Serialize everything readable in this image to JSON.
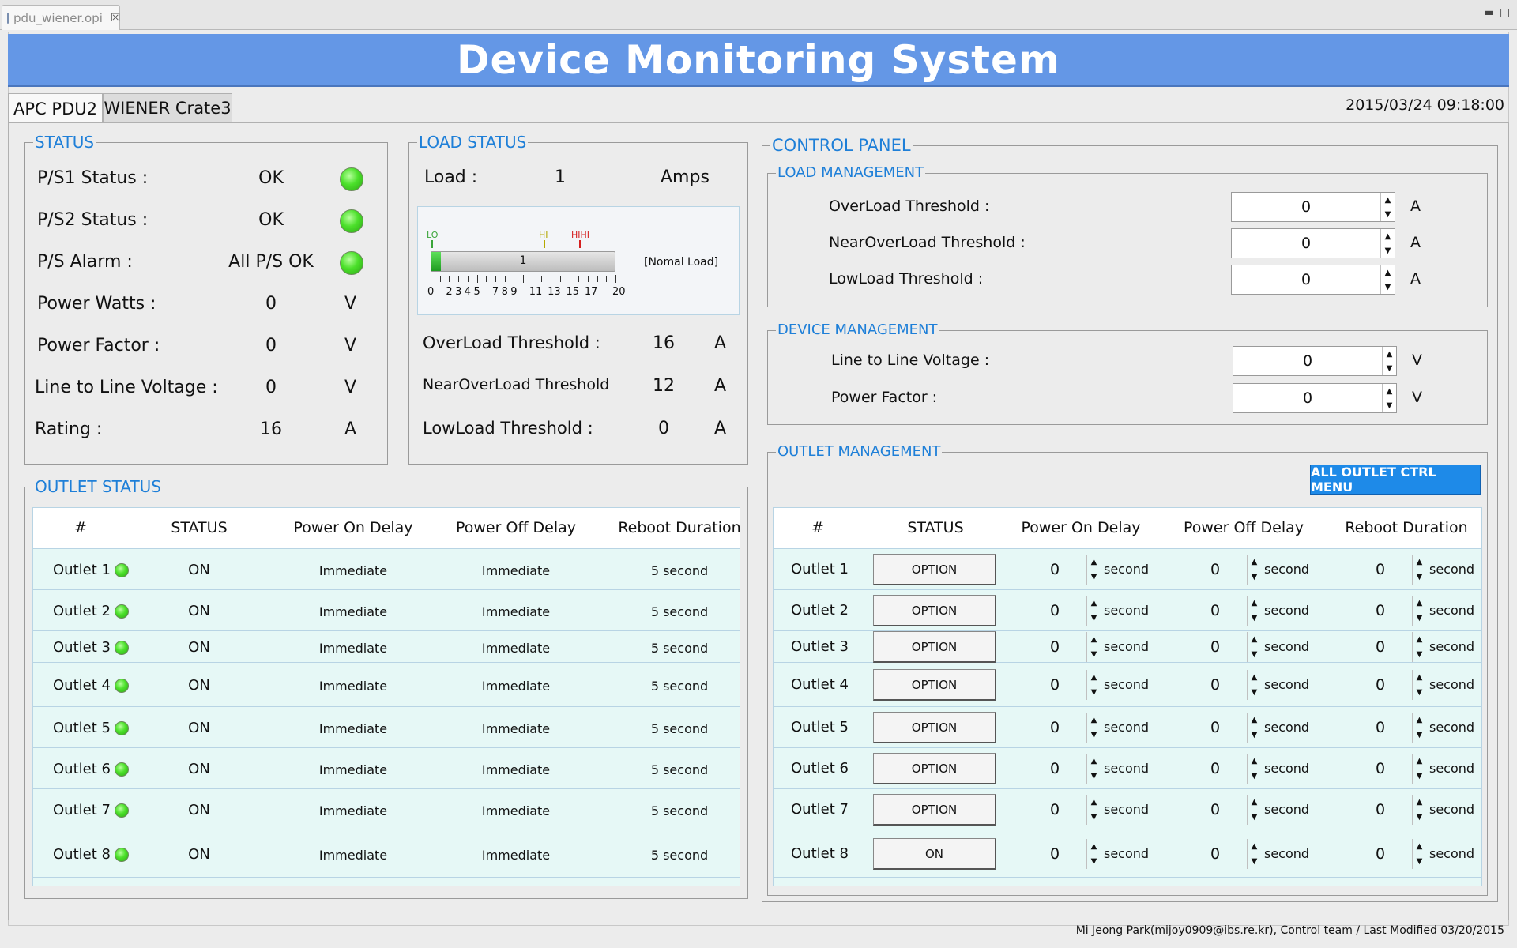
{
  "editor_tab": {
    "title": "pdu_wiener.opi",
    "close": "☒"
  },
  "banner": {
    "title": "Device Monitoring System"
  },
  "device_tabs": [
    {
      "label": "APC PDU2"
    },
    {
      "label": "WIENER Crate3"
    }
  ],
  "datetime": "2015/03/24 09:18:00",
  "status": {
    "title": "STATUS",
    "rows": [
      {
        "label": "P/S1 Status :",
        "value": "OK",
        "indicator": "led-green"
      },
      {
        "label": "P/S2 Status :",
        "value": "OK",
        "indicator": "led-green"
      },
      {
        "label": "P/S Alarm :",
        "value": "All P/S OK",
        "indicator": "led-green"
      },
      {
        "label": "Power Watts :",
        "value": "0",
        "unit": "V"
      },
      {
        "label": "Power Factor :",
        "value": "0",
        "unit": "V"
      },
      {
        "label": "Line to Line Voltage :",
        "value": "0",
        "unit": "V"
      },
      {
        "label": "Rating :",
        "value": "16",
        "unit": "A"
      }
    ]
  },
  "load_status": {
    "title": "LOAD STATUS",
    "load_label": "Load :",
    "load_value": "1",
    "load_unit": "Amps",
    "gauge": {
      "value": 1,
      "min": 0,
      "max": 20,
      "value_text": "1",
      "lo_label": "LO",
      "hi_label": "HI",
      "hihi_label": "HIHI",
      "state": "[Nomal Load]",
      "ticks": [
        "0",
        "2",
        "3",
        "4",
        "5",
        "7",
        "8",
        "9",
        "11",
        "13",
        "15",
        "17",
        "20"
      ]
    },
    "rows": [
      {
        "label": "OverLoad Threshold :",
        "value": "16",
        "unit": "A"
      },
      {
        "label": "NearOverLoad Threshold",
        "value": "12",
        "unit": "A"
      },
      {
        "label": "LowLoad Threshold :",
        "value": "0",
        "unit": "A"
      }
    ]
  },
  "outlet_status": {
    "title": "OUTLET STATUS",
    "headers": [
      "#",
      "STATUS",
      "Power On Delay",
      "Power Off Delay",
      "Reboot Duration"
    ],
    "rows": [
      {
        "name": "Outlet 1",
        "status": "ON",
        "on_delay": "Immediate",
        "off_delay": "Immediate",
        "reboot": "5 second"
      },
      {
        "name": "Outlet 2",
        "status": "ON",
        "on_delay": "Immediate",
        "off_delay": "Immediate",
        "reboot": "5 second"
      },
      {
        "name": "Outlet 3",
        "status": "ON",
        "on_delay": "Immediate",
        "off_delay": "Immediate",
        "reboot": "5 second"
      },
      {
        "name": "Outlet 4",
        "status": "ON",
        "on_delay": "Immediate",
        "off_delay": "Immediate",
        "reboot": "5 second"
      },
      {
        "name": "Outlet 5",
        "status": "ON",
        "on_delay": "Immediate",
        "off_delay": "Immediate",
        "reboot": "5 second"
      },
      {
        "name": "Outlet 6",
        "status": "ON",
        "on_delay": "Immediate",
        "off_delay": "Immediate",
        "reboot": "5 second"
      },
      {
        "name": "Outlet 7",
        "status": "ON",
        "on_delay": "Immediate",
        "off_delay": "Immediate",
        "reboot": "5 second"
      },
      {
        "name": "Outlet 8",
        "status": "ON",
        "on_delay": "Immediate",
        "off_delay": "Immediate",
        "reboot": "5 second"
      }
    ]
  },
  "control_panel": {
    "title": "CONTROL PANEL",
    "load_mgmt": {
      "title": "LOAD MANAGEMENT",
      "rows": [
        {
          "label": "OverLoad Threshold :",
          "value": "0",
          "unit": "A"
        },
        {
          "label": "NearOverLoad Threshold :",
          "value": "0",
          "unit": "A"
        },
        {
          "label": "LowLoad Threshold :",
          "value": "0",
          "unit": "A"
        }
      ]
    },
    "device_mgmt": {
      "title": "DEVICE MANAGEMENT",
      "rows": [
        {
          "label": "Line to Line Voltage :",
          "value": "0",
          "unit": "V"
        },
        {
          "label": "Power Factor :",
          "value": "0",
          "unit": "V"
        }
      ]
    },
    "outlet_mgmt": {
      "title": "OUTLET MANAGEMENT",
      "ctrl_menu_label": "ALL OUTLET CTRL MENU",
      "headers": [
        "#",
        "STATUS",
        "Power On Delay",
        "Power Off Delay",
        "Reboot Duration"
      ],
      "unit": "second",
      "rows": [
        {
          "name": "Outlet 1",
          "button": "OPTION",
          "on": "0",
          "off": "0",
          "reboot": "0"
        },
        {
          "name": "Outlet 2",
          "button": "OPTION",
          "on": "0",
          "off": "0",
          "reboot": "0"
        },
        {
          "name": "Outlet 3",
          "button": "OPTION",
          "on": "0",
          "off": "0",
          "reboot": "0"
        },
        {
          "name": "Outlet 4",
          "button": "OPTION",
          "on": "0",
          "off": "0",
          "reboot": "0"
        },
        {
          "name": "Outlet 5",
          "button": "OPTION",
          "on": "0",
          "off": "0",
          "reboot": "0"
        },
        {
          "name": "Outlet 6",
          "button": "OPTION",
          "on": "0",
          "off": "0",
          "reboot": "0"
        },
        {
          "name": "Outlet 7",
          "button": "OPTION",
          "on": "0",
          "off": "0",
          "reboot": "0"
        },
        {
          "name": "Outlet 8",
          "button": "ON",
          "on": "0",
          "off": "0",
          "reboot": "0"
        }
      ]
    }
  },
  "footer": "Mi Jeong Park(mijoy0909@ibs.re.kr),  Control team / Last Modified 03/20/2015",
  "colors": {
    "banner": "#6497e6",
    "group_title": "#1e7fd8",
    "led_on": "#4be02a",
    "ctrl_button": "#1e8ae8",
    "table_row": "#e6f8f6"
  }
}
